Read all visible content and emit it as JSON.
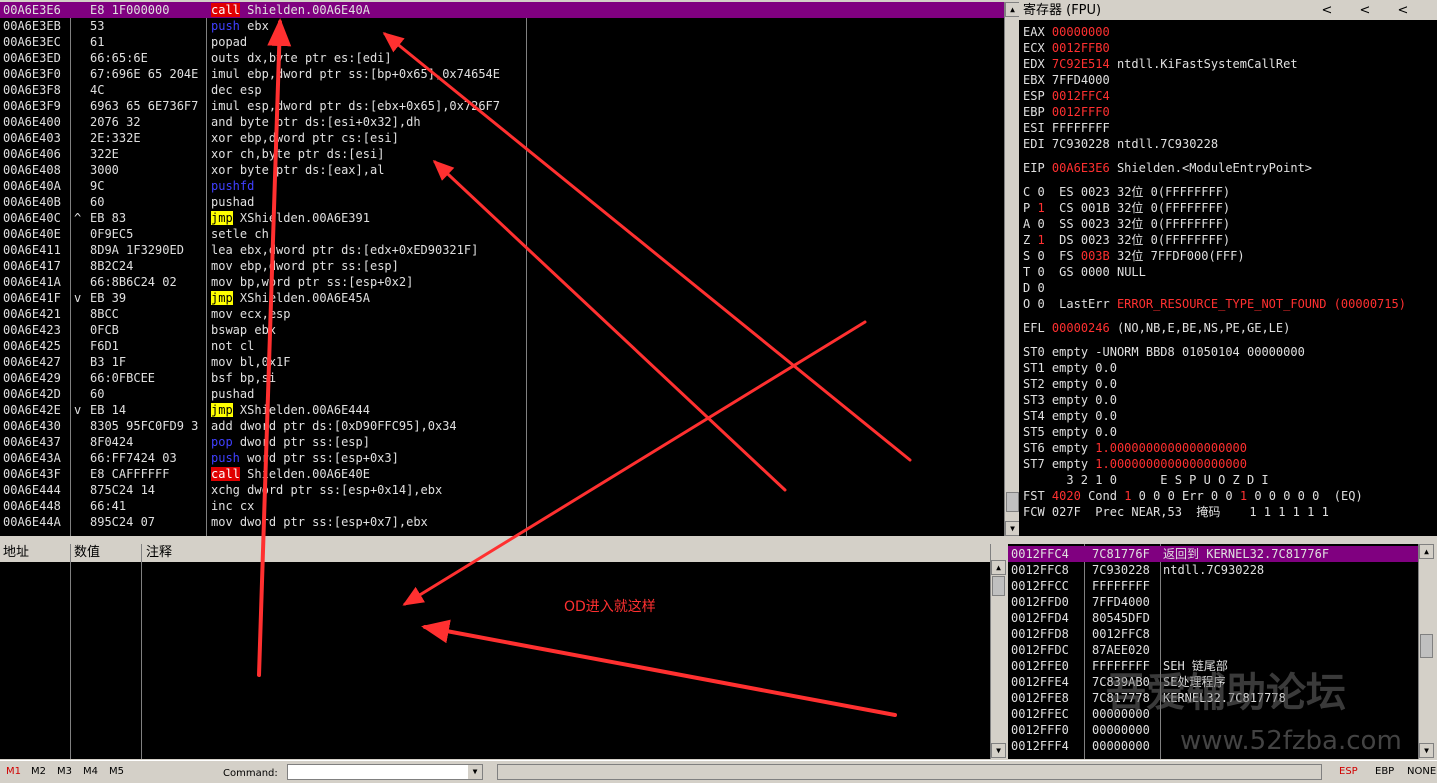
{
  "disasm": {
    "rows": [
      {
        "addr": "00A6E3E6",
        "mark": "",
        "hex": "E8 1F000000",
        "op": "call",
        "op_style": "hl-red",
        "arg": "Shielden.00A6E40A",
        "sel": true
      },
      {
        "addr": "00A6E3EB",
        "mark": "",
        "hex": "53",
        "op": "push",
        "op_style": "push",
        "arg": "ebx"
      },
      {
        "addr": "00A6E3EC",
        "mark": "",
        "hex": "61",
        "op": "popad",
        "op_style": "",
        "arg": ""
      },
      {
        "addr": "00A6E3ED",
        "mark": "",
        "hex": "66:65:6E",
        "op": "outs",
        "op_style": "",
        "arg": "dx,byte ptr es:[edi]"
      },
      {
        "addr": "00A6E3F0",
        "mark": "",
        "hex": "67:696E 65 204E",
        "op": "imul",
        "op_style": "",
        "arg": "ebp,dword ptr ss:[bp+0x65],0x74654E"
      },
      {
        "addr": "00A6E3F8",
        "mark": "",
        "hex": "4C",
        "op": "dec",
        "op_style": "",
        "arg": "esp"
      },
      {
        "addr": "00A6E3F9",
        "mark": "",
        "hex": "6963 65 6E736F7",
        "op": "imul",
        "op_style": "",
        "arg": "esp,dword ptr ds:[ebx+0x65],0x726F7"
      },
      {
        "addr": "00A6E400",
        "mark": "",
        "hex": "2076 32",
        "op": "and",
        "op_style": "",
        "arg": "byte ptr ds:[esi+0x32],dh"
      },
      {
        "addr": "00A6E403",
        "mark": "",
        "hex": "2E:332E",
        "op": "xor",
        "op_style": "",
        "arg": "ebp,dword ptr cs:[esi]"
      },
      {
        "addr": "00A6E406",
        "mark": "",
        "hex": "322E",
        "op": "xor",
        "op_style": "",
        "arg": "ch,byte ptr ds:[esi]"
      },
      {
        "addr": "00A6E408",
        "mark": "",
        "hex": "3000",
        "op": "xor",
        "op_style": "",
        "arg": "byte ptr ds:[eax],al"
      },
      {
        "addr": "00A6E40A",
        "mark": "",
        "hex": "9C",
        "op": "pushfd",
        "op_style": "push",
        "arg": ""
      },
      {
        "addr": "00A6E40B",
        "mark": "",
        "hex": "60",
        "op": "pushad",
        "op_style": "",
        "arg": ""
      },
      {
        "addr": "00A6E40C",
        "mark": "^",
        "hex": "EB 83",
        "op": "jmp",
        "op_style": "hl-yel",
        "arg": "XShielden.00A6E391"
      },
      {
        "addr": "00A6E40E",
        "mark": "",
        "hex": "0F9EC5",
        "op": "setle",
        "op_style": "",
        "arg": "ch"
      },
      {
        "addr": "00A6E411",
        "mark": "",
        "hex": "8D9A 1F3290ED",
        "op": "lea",
        "op_style": "",
        "arg": "ebx,dword ptr ds:[edx+0xED90321F]"
      },
      {
        "addr": "00A6E417",
        "mark": "",
        "hex": "8B2C24",
        "op": "mov",
        "op_style": "",
        "arg": "ebp,dword ptr ss:[esp]"
      },
      {
        "addr": "00A6E41A",
        "mark": "",
        "hex": "66:8B6C24 02",
        "op": "mov",
        "op_style": "",
        "arg": "bp,word ptr ss:[esp+0x2]"
      },
      {
        "addr": "00A6E41F",
        "mark": "v",
        "hex": "EB 39",
        "op": "jmp",
        "op_style": "hl-yel",
        "arg": "XShielden.00A6E45A"
      },
      {
        "addr": "00A6E421",
        "mark": "",
        "hex": "8BCC",
        "op": "mov",
        "op_style": "",
        "arg": "ecx,esp"
      },
      {
        "addr": "00A6E423",
        "mark": "",
        "hex": "0FCB",
        "op": "bswap",
        "op_style": "",
        "arg": "ebx"
      },
      {
        "addr": "00A6E425",
        "mark": "",
        "hex": "F6D1",
        "op": "not",
        "op_style": "",
        "arg": "cl"
      },
      {
        "addr": "00A6E427",
        "mark": "",
        "hex": "B3 1F",
        "op": "mov",
        "op_style": "",
        "arg": "bl,0x1F"
      },
      {
        "addr": "00A6E429",
        "mark": "",
        "hex": "66:0FBCEE",
        "op": "bsf",
        "op_style": "",
        "arg": "bp,si"
      },
      {
        "addr": "00A6E42D",
        "mark": "",
        "hex": "60",
        "op": "pushad",
        "op_style": "",
        "arg": ""
      },
      {
        "addr": "00A6E42E",
        "mark": "v",
        "hex": "EB 14",
        "op": "jmp",
        "op_style": "hl-yel",
        "arg": "XShielden.00A6E444"
      },
      {
        "addr": "00A6E430",
        "mark": "",
        "hex": "8305 95FC0FD9 3",
        "op": "add",
        "op_style": "",
        "arg": "dword ptr ds:[0xD90FFC95],0x34"
      },
      {
        "addr": "00A6E437",
        "mark": "",
        "hex": "8F0424",
        "op": "pop",
        "op_style": "push",
        "arg": "dword ptr ss:[esp]"
      },
      {
        "addr": "00A6E43A",
        "mark": "",
        "hex": "66:FF7424 03",
        "op": "push",
        "op_style": "push",
        "arg": "word ptr ss:[esp+0x3]"
      },
      {
        "addr": "00A6E43F",
        "mark": "",
        "hex": "E8 CAFFFFFF",
        "op": "call",
        "op_style": "hl-red",
        "arg": "Shielden.00A6E40E"
      },
      {
        "addr": "00A6E444",
        "mark": "",
        "hex": "875C24 14",
        "op": "xchg",
        "op_style": "",
        "arg": "dword ptr ss:[esp+0x14],ebx"
      },
      {
        "addr": "00A6E448",
        "mark": "",
        "hex": "66:41",
        "op": "inc",
        "op_style": "",
        "arg": "cx"
      },
      {
        "addr": "00A6E44A",
        "mark": "",
        "hex": "895C24 07",
        "op": "mov",
        "op_style": "",
        "arg": "dword ptr ss:[esp+0x7],ebx"
      }
    ]
  },
  "registers": {
    "title": "寄存器 (FPU)",
    "nav": [
      "<",
      "<",
      "<"
    ],
    "lines": [
      {
        "name": "EAX",
        "val": "00000000",
        "red": true,
        "comment": ""
      },
      {
        "name": "ECX",
        "val": "0012FFB0",
        "red": true,
        "comment": ""
      },
      {
        "name": "EDX",
        "val": "7C92E514",
        "red": true,
        "comment": "ntdll.KiFastSystemCallRet"
      },
      {
        "name": "EBX",
        "val": "7FFD4000",
        "red": false,
        "comment": ""
      },
      {
        "name": "ESP",
        "val": "0012FFC4",
        "red": true,
        "comment": ""
      },
      {
        "name": "EBP",
        "val": "0012FFF0",
        "red": true,
        "comment": ""
      },
      {
        "name": "ESI",
        "val": "FFFFFFFF",
        "red": false,
        "comment": ""
      },
      {
        "name": "EDI",
        "val": "7C930228",
        "red": false,
        "comment": "ntdll.7C930228"
      },
      {
        "name": "",
        "val": "",
        "red": false,
        "comment": ""
      },
      {
        "name": "EIP",
        "val": "00A6E3E6",
        "red": true,
        "comment": "Shielden.<ModuleEntryPoint>"
      }
    ],
    "flags": [
      {
        "f": "C",
        "v": "0",
        "red": false,
        "seg": "ES",
        "sv": "0023",
        "bits": "32位",
        "rng": "0(FFFFFFFF)",
        "segred": false
      },
      {
        "f": "P",
        "v": "1",
        "red": true,
        "seg": "CS",
        "sv": "001B",
        "bits": "32位",
        "rng": "0(FFFFFFFF)",
        "segred": false
      },
      {
        "f": "A",
        "v": "0",
        "red": false,
        "seg": "SS",
        "sv": "0023",
        "bits": "32位",
        "rng": "0(FFFFFFFF)",
        "segred": false
      },
      {
        "f": "Z",
        "v": "1",
        "red": true,
        "seg": "DS",
        "sv": "0023",
        "bits": "32位",
        "rng": "0(FFFFFFFF)",
        "segred": false
      },
      {
        "f": "S",
        "v": "0",
        "red": false,
        "seg": "FS",
        "sv": "003B",
        "bits": "32位",
        "rng": "7FFDF000(FFF)",
        "segred": true
      },
      {
        "f": "T",
        "v": "0",
        "red": false,
        "seg": "GS",
        "sv": "0000",
        "bits": "NULL",
        "rng": "",
        "segred": false
      },
      {
        "f": "D",
        "v": "0",
        "red": false,
        "seg": "",
        "sv": "",
        "bits": "",
        "rng": "",
        "segred": false
      }
    ],
    "lasterr": {
      "f": "O 0",
      "label": "LastErr",
      "val": "ERROR_RESOURCE_TYPE_NOT_FOUND (00000715)"
    },
    "efl": {
      "label": "EFL",
      "val": "00000246",
      "desc": "(NO,NB,E,BE,NS,PE,GE,LE)"
    },
    "st": [
      {
        "n": "ST0",
        "s": "empty",
        "v": "-UNORM BBD8 01050104 00000000",
        "red": false
      },
      {
        "n": "ST1",
        "s": "empty",
        "v": "0.0",
        "red": false
      },
      {
        "n": "ST2",
        "s": "empty",
        "v": "0.0",
        "red": false
      },
      {
        "n": "ST3",
        "s": "empty",
        "v": "0.0",
        "red": false
      },
      {
        "n": "ST4",
        "s": "empty",
        "v": "0.0",
        "red": false
      },
      {
        "n": "ST5",
        "s": "empty",
        "v": "0.0",
        "red": false
      },
      {
        "n": "ST6",
        "s": "empty",
        "v": "1.0000000000000000000",
        "red": true
      },
      {
        "n": "ST7",
        "s": "empty",
        "v": "1.0000000000000000000",
        "red": true
      }
    ],
    "fpu_hdr": "      3 2 1 0      E S P U O Z D I",
    "fst": {
      "label": "FST",
      "val": "4020",
      "a": "Cond",
      "b": "0 0 0",
      "b1": "1",
      "c": "Err 0 0",
      "c1": "1",
      "d": "0 0 0 0 0",
      "e": "(EQ)"
    },
    "fcw": {
      "label": "FCW",
      "val": "027F",
      "rest": "Prec NEAR,53  掩码    1 1 1 1 1 1"
    }
  },
  "dump": {
    "headers": [
      "地址",
      "数值",
      "注释"
    ]
  },
  "stack": {
    "rows": [
      {
        "addr": "0012FFC4",
        "val": "7C81776F",
        "com": "返回到 KERNEL32.7C81776F",
        "sel": true
      },
      {
        "addr": "0012FFC8",
        "val": "7C930228",
        "com": "ntdll.7C930228"
      },
      {
        "addr": "0012FFCC",
        "val": "FFFFFFFF",
        "com": ""
      },
      {
        "addr": "0012FFD0",
        "val": "7FFD4000",
        "com": ""
      },
      {
        "addr": "0012FFD4",
        "val": "80545DFD",
        "com": ""
      },
      {
        "addr": "0012FFD8",
        "val": "0012FFC8",
        "com": ""
      },
      {
        "addr": "0012FFDC",
        "val": "87AEE020",
        "com": ""
      },
      {
        "addr": "0012FFE0",
        "val": "FFFFFFFF",
        "com": "SEH 链尾部"
      },
      {
        "addr": "0012FFE4",
        "val": "7C839AB0",
        "com": "SE处理程序"
      },
      {
        "addr": "0012FFE8",
        "val": "7C817778",
        "com": "KERNEL32.7C817778"
      },
      {
        "addr": "0012FFEC",
        "val": "00000000",
        "com": ""
      },
      {
        "addr": "0012FFF0",
        "val": "00000000",
        "com": ""
      },
      {
        "addr": "0012FFF4",
        "val": "00000000",
        "com": ""
      }
    ]
  },
  "bottom": {
    "mbuttons": [
      "M1",
      "M2",
      "M3",
      "M4",
      "M5"
    ],
    "command_label": "Command:",
    "rbuttons": [
      "ESP",
      "EBP",
      "NONE"
    ]
  },
  "annotation": {
    "text": "OD进入就这样",
    "color": "#ff3030"
  },
  "watermark": {
    "text": "吾爱辅助论坛",
    "url": "www.52fzba.com"
  }
}
